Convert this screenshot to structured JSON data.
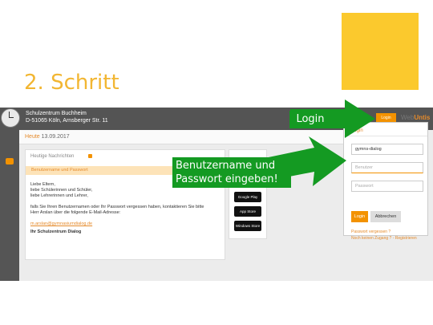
{
  "slide": {
    "title": "2. Schritt"
  },
  "app": {
    "school_name": "Schulzentrum Buchheim",
    "school_address": "D-51065 Köln, Arnsberger Str. 11",
    "brand_web": "Web",
    "brand_untis": "Untis",
    "top_login_label": "Login"
  },
  "subbar": {
    "today_label": "Heute",
    "date": "13.09.2017"
  },
  "news": {
    "title": "Heutige Nachrichten",
    "subtitle": "Benutzername und Passwort",
    "greeting1": "Liebe Eltern,",
    "greeting2": "liebe Schülerinnen und Schüler,",
    "greeting3": "liebe Lehrerinnen und Lehrer,",
    "paragraph1": "falls Sie Ihren Benutzernamen oder Ihr Passwort vergessen haben, kontaktieren Sie bitte",
    "paragraph2": "Herr Arslan über die folgende E-Mail-Adresse:",
    "email": "m.arslan@gymnasiumdialog.de",
    "signature": "Ihr Schulzentrum Dialog"
  },
  "stores": {
    "google": "Google Play",
    "apple": "App Store",
    "windows": "Windows Store"
  },
  "login_panel": {
    "title": "Login",
    "school_value": "gymns-dialog",
    "username_placeholder": "Benutzer",
    "password_placeholder": "Passwort",
    "login_button": "Login",
    "cancel_button": "Abbrechen",
    "forgot_link": "Passwort vergessen ?",
    "register_link": "Noch keinen Zugang ? - Registrieren"
  },
  "annotations": {
    "login_label": "Login",
    "credentials_line1": "Benutzername und",
    "credentials_line2": "Passwort eingeben!"
  },
  "colors": {
    "accent": "#f39200",
    "annotation_green": "#149a22",
    "title_yellow": "#f2b632"
  }
}
